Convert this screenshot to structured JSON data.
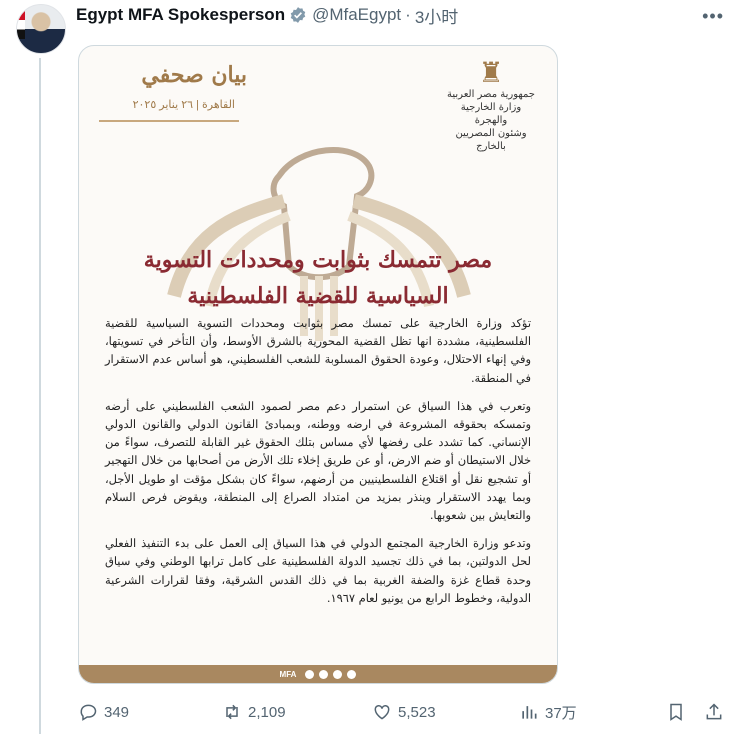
{
  "tweet": {
    "author_name": "Egypt MFA Spokesperson",
    "handle": "@MfaEgypt",
    "separator": "·",
    "time": "3小时",
    "more_icon": "more-dots-icon"
  },
  "document": {
    "title": "بيان صحفي",
    "date": "القاهرة | ٢٦ يناير ٢٠٢٥",
    "ministry_lines": [
      "جمهورية مصر العربية",
      "وزارة الخارجية والهجرة",
      "وشئون المصريين بالخارج"
    ],
    "headline_lines": [
      "مصر تتمسك بثوابت ومحددات التسوية",
      "السياسية للقضية الفلسطينية"
    ],
    "paragraphs": [
      "تؤكد وزارة الخارجية على تمسك مصر بثوابت ومحددات التسوية السياسية للقضية الفلسطينية، مشددة انها تظل القضية المحورية بالشرق الأوسط، وأن التأخر في تسويتها، وفي إنهاء الاحتلال، وعودة الحقوق المسلوبة للشعب الفلسطيني، هو أساس عدم الاستقرار في المنطقة.",
      "وتعرب في هذا السياق عن استمرار دعم مصر لصمود الشعب الفلسطيني على أرضه وتمسكه بحقوقه المشروعة في ارضه ووطنه، وبمبادئ القانون الدولي والقانون الدولي الإنساني. كما تشدد على رفضها لأي مساس بتلك الحقوق غير القابلة للتصرف، سواءً من خلال الاستيطان أو ضم الارض، أو عن طريق إخلاء تلك الأرض من أصحابها من خلال التهجير أو تشجيع نقل أو اقتلاع الفلسطينيين من أرضهم، سواءً كان بشكل مؤقت او طويل الأجل، وبما يهدد الاستقرار وينذر بمزيد من امتداد الصراع إلى المنطقة، ويقوض فرص السلام والتعايش بين شعوبها.",
      "وتدعو وزارة الخارجية المجتمع الدولي في هذا السياق إلى العمل على بدء التنفيذ الفعلي لحل الدولتين، بما في ذلك تجسيد الدولة الفلسطينية على كامل ترابها الوطني وفي سياق وحدة قطاع غزة والضفة الغربية بما في ذلك القدس الشرقية، وفقا لقرارات الشرعية الدولية، وخطوط الرابع من يونيو لعام ١٩٦٧."
    ],
    "footer_label": "MFA"
  },
  "actions": {
    "replies": "349",
    "reposts": "2,109",
    "likes": "5,523",
    "views": "37万"
  },
  "colors": {
    "accent_brown": "#a07a4a",
    "headline_red": "#8a2a32",
    "muted_text": "#536471",
    "verified": "#829aab"
  }
}
